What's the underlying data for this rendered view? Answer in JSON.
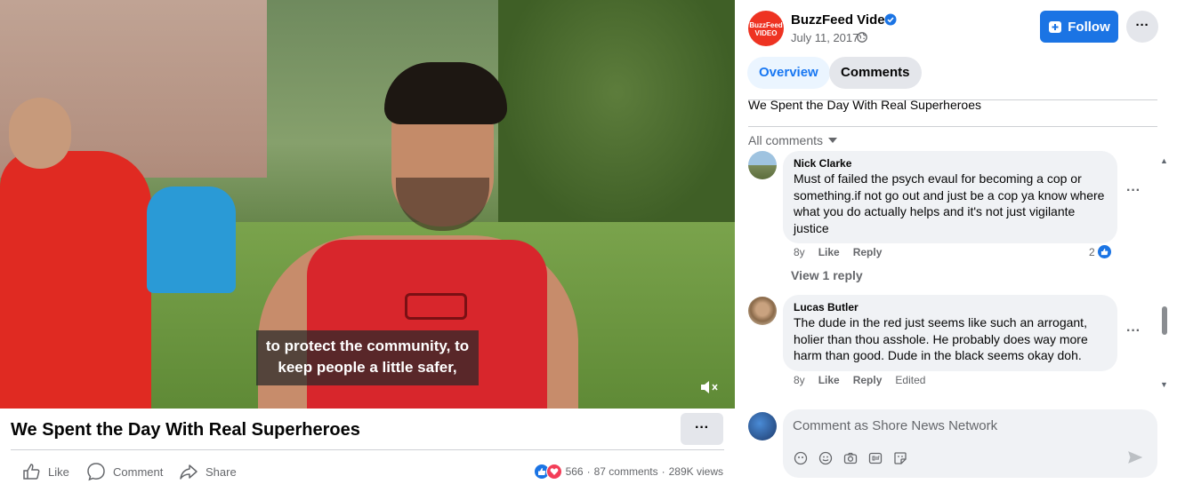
{
  "video": {
    "subtitle_line1": "to protect the community, to",
    "subtitle_line2": "keep people a little safer,",
    "title": "We Spent the Day With Real Superheroes"
  },
  "actions": {
    "like": "Like",
    "comment": "Comment",
    "share": "Share",
    "reactions_count": "566",
    "comments_count": "87 comments",
    "views": "289K views"
  },
  "page": {
    "logo_line1": "BuzzFeed",
    "logo_line2": "VIDEO",
    "name": "BuzzFeed Video",
    "date": "July 11, 2017 ·",
    "follow": "Follow",
    "accent": "#1b74e4"
  },
  "tabs": [
    {
      "label": "Overview",
      "active": true
    },
    {
      "label": "Comments",
      "active": false
    }
  ],
  "description": "We Spent the Day With Real Superheroes",
  "all_comments": "All comments",
  "comments": [
    {
      "author": "Nick Clarke",
      "text": "Must of failed the psych evaul for becoming a cop or something.if not go out and just be a cop ya know where what you do actually helps and it's not just vigilante justice",
      "age": "8y",
      "like": "Like",
      "reply": "Reply",
      "reactions": "2",
      "view_replies": "View 1 reply"
    },
    {
      "author": "Lucas Butler",
      "text": "The dude in the red just seems like such an arrogant, holier than thou asshole. He probably does way more harm than good. Dude in the black seems okay doh.",
      "age": "8y",
      "like": "Like",
      "reply": "Reply",
      "edited": "Edited"
    }
  ],
  "composer": {
    "placeholder": "Comment as Shore News Network"
  }
}
